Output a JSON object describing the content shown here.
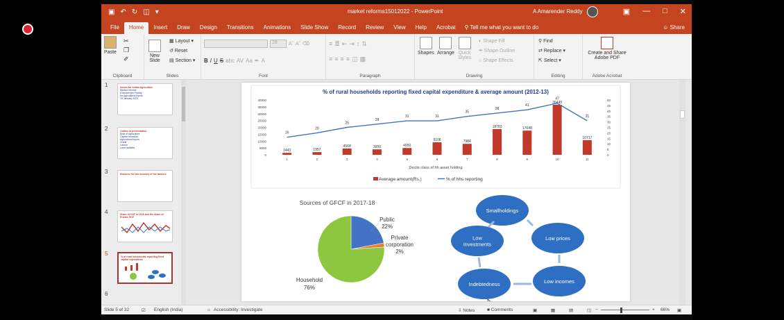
{
  "window": {
    "title": "market reforms15012022 - PowerPoint",
    "user": "A Amarender Reddy"
  },
  "tabs": [
    "File",
    "Home",
    "Insert",
    "Draw",
    "Design",
    "Transitions",
    "Animations",
    "Slide Show",
    "Record",
    "Review",
    "View",
    "Help",
    "Acrobat"
  ],
  "active_tab": "Home",
  "tell_me": "Tell me what you want to do",
  "share": "Share",
  "ribbon": {
    "clipboard": {
      "paste": "Paste",
      "label": "Clipboard"
    },
    "slides": {
      "new_slide_1": "New",
      "new_slide_2": "Slide",
      "layout": "Layout",
      "reset": "Reset",
      "section": "Section",
      "label": "Slides"
    },
    "font": {
      "size": "28",
      "bold": "B",
      "italic": "I",
      "underline": "U",
      "strike": "S",
      "spacing": "abc",
      "case": "AV",
      "aa": "Aa",
      "label": "Font"
    },
    "paragraph": {
      "label": "Paragraph"
    },
    "drawing": {
      "shapes": "Shapes",
      "arrange": "Arrange",
      "quick": "Quick",
      "styles": "Styles",
      "fill": "Shape Fill",
      "outline": "Shape Outline",
      "effects": "Shape Effects",
      "label": "Drawing"
    },
    "editing": {
      "find": "Find",
      "replace": "Replace",
      "select": "Select",
      "label": "Editing"
    },
    "acrobat": {
      "create_1": "Create and Share",
      "create_2": "Adobe PDF",
      "label": "Adobe Acrobat"
    }
  },
  "thumbnails": [
    {
      "num": "1",
      "lines": [
        "Issues for Indian Agriculture",
        "Market reforms",
        "A Amarender Reddy",
        "for Agricultural Inputs",
        "15 January 2022"
      ]
    },
    {
      "num": "2",
      "lines": [
        "Outline of presentation",
        "Role of agriculture",
        "Capital formation",
        "Agricultural inputs",
        "Credit",
        "Labour",
        "Land markets"
      ]
    },
    {
      "num": "3",
      "lines": [
        "Reasons for low incomes of the farmers"
      ]
    },
    {
      "num": "4",
      "lines": [
        "Share of GCF in GVA and the share of Private GCF"
      ]
    },
    {
      "num": "5",
      "lines": [
        "% of rural households reporting fixed capital expenditure"
      ]
    },
    {
      "num": "6",
      "lines": []
    }
  ],
  "slide": {
    "sources_title": "Sources of GFCF in 2017-18",
    "cycle": [
      "Smallholdings",
      "Low prices",
      "Low incomes",
      "Indebtedness",
      "Low investments"
    ]
  },
  "status": {
    "slide_of": "Slide 5 of 32",
    "language": "English (India)",
    "accessibility": "Accessibility: Investigate",
    "notes": "Notes",
    "comments": "Comments",
    "zoom": "66%"
  },
  "colors": {
    "accent": "#c4441f",
    "bar": "#c0392b",
    "line": "#4472c4",
    "pie_household": "#8dc63f",
    "pie_public": "#4472c4",
    "pie_private": "#ed7d31",
    "cycle_fill": "#2e6fc3"
  },
  "chart_data": [
    {
      "type": "bar",
      "title": "% of  rural households reporting fixed capital expenditure & average amount (2012-13)",
      "xlabel": "Decile class of hh asset holding",
      "categories": [
        "1",
        "2",
        "3",
        "4",
        "5",
        "6",
        "7",
        "8",
        "9",
        "10",
        "11"
      ],
      "series": [
        {
          "name": "Average amount(Rs.)",
          "type": "bar",
          "axis": "left",
          "values": [
            1443,
            1957,
            4568,
            3950,
            4950,
            9108,
            7984,
            18783,
            17648,
            36449,
            10717
          ]
        },
        {
          "name": "% of hhs reporting",
          "type": "line",
          "axis": "right",
          "values": [
            16,
            20,
            25,
            28,
            31,
            31,
            35,
            38,
            41,
            47,
            31
          ]
        }
      ],
      "ylim": [
        0,
        40000
      ],
      "yticks": [
        "40000",
        "35000",
        "30000",
        "25000",
        "20000",
        "15000",
        "10000",
        "5000",
        "0"
      ],
      "y2lim": [
        0,
        50
      ],
      "y2ticks": [
        "50",
        "45",
        "40",
        "35",
        "30",
        "25",
        "20",
        "15",
        "10",
        "5",
        "0"
      ],
      "legend": "bottom"
    },
    {
      "type": "pie",
      "title": "Sources of GFCF in 2017-18",
      "categories": [
        "Public",
        "Private corporation",
        "Household"
      ],
      "values": [
        22,
        2,
        76
      ],
      "labels": [
        "Public",
        "22%",
        "Private",
        "corporation",
        "2%",
        "Household",
        "76%"
      ]
    }
  ]
}
